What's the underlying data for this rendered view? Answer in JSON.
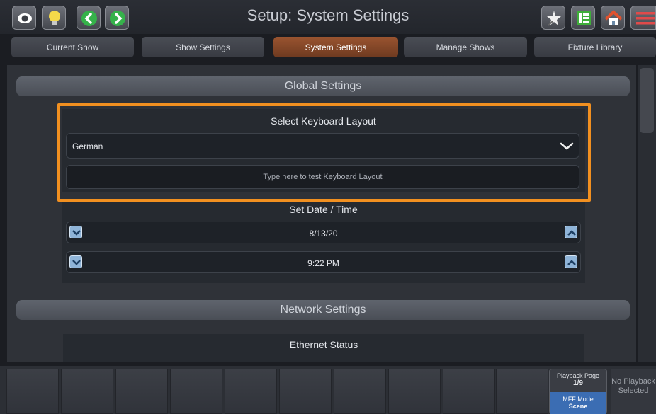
{
  "header": {
    "title": "Setup: System Settings",
    "left_icons": [
      "eye-icon",
      "lightbulb-icon",
      "back-arrow-icon",
      "forward-arrow-icon"
    ],
    "right_icons": [
      "magic-wand-icon",
      "grid-icon",
      "home-icon",
      "menu-icon"
    ]
  },
  "tabs": [
    {
      "label": "Current Show"
    },
    {
      "label": "Show Settings"
    },
    {
      "label": "System Settings"
    },
    {
      "label": "Manage Shows"
    },
    {
      "label": "Fixture Library"
    }
  ],
  "global_settings": {
    "heading": "Global Settings",
    "keyboard": {
      "title": "Select Keyboard Layout",
      "selected": "German",
      "test_placeholder": "Type here to test Keyboard Layout"
    },
    "datetime": {
      "title": "Set Date / Time",
      "date": "8/13/20",
      "time": "9:22 PM"
    }
  },
  "network_settings": {
    "heading": "Network Settings",
    "ethernet_title": "Ethernet Status"
  },
  "bottom": {
    "playback_page_label": "Playback Page",
    "playback_page_value": "1/9",
    "mff_mode_label": "MFF Mode",
    "mff_mode_value": "Scene",
    "no_playback": "No Playback Selected"
  },
  "colors": {
    "accent_orange": "#f29020",
    "active_tab": "#9a5430",
    "spin_button": "#8fb4d8",
    "mff_blue": "#3b6db3"
  }
}
